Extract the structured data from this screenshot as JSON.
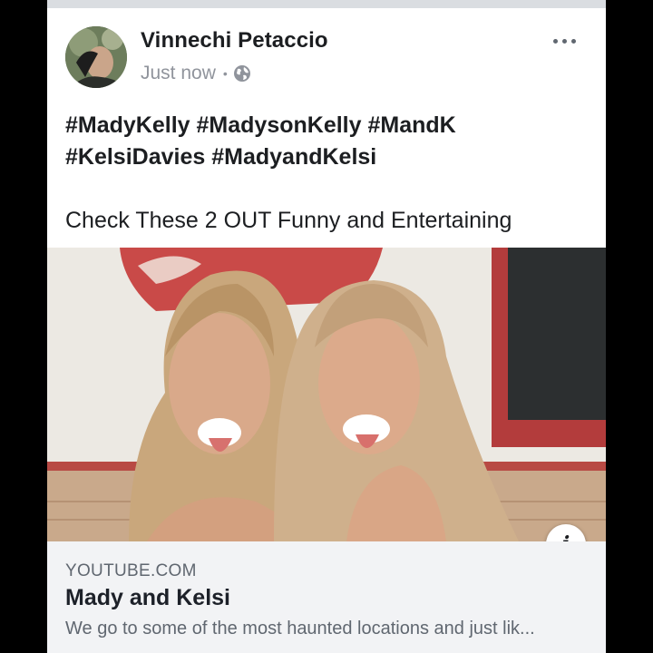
{
  "post": {
    "author": "Vinnechi Petaccio",
    "timestamp": "Just now",
    "separator": "•",
    "privacy_icon": "globe-icon",
    "hashtags": [
      "#MadyKelly",
      "#MadysonKelly",
      "#MandK",
      "#KelsiDavies",
      "#MadyandKelsi"
    ],
    "text": "Check These 2 OUT Funny and Entertaining"
  },
  "link": {
    "domain": "YOUTUBE.COM",
    "title": "Mady and Kelsi",
    "description": "We go to some of the most haunted locations and just lik..."
  },
  "icons": {
    "more": "more-options-icon",
    "info": "info-icon",
    "info_glyph": "i"
  },
  "colors": {
    "card_bg": "#ffffff",
    "caption_bg": "#f2f3f5",
    "text_primary": "#1c1e21",
    "text_secondary": "#606770",
    "frame": "#000000"
  }
}
